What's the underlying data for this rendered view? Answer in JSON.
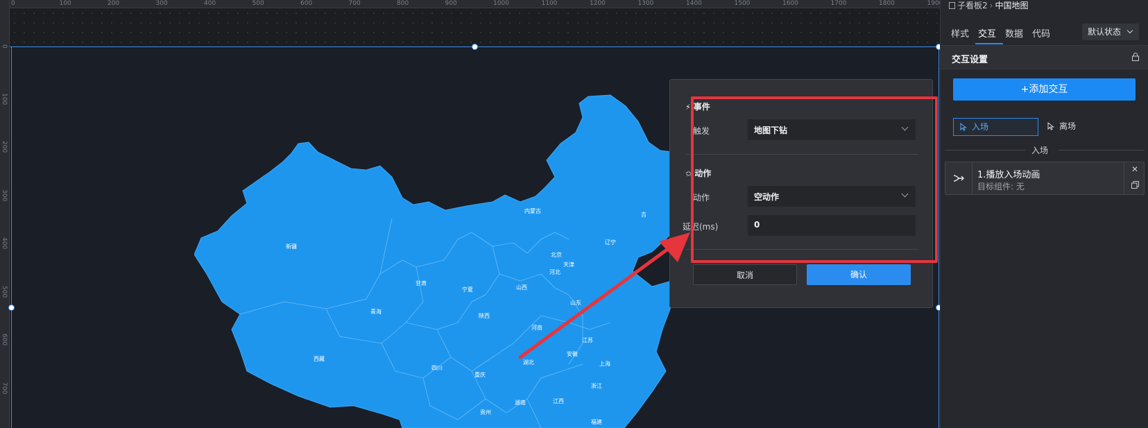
{
  "ruler": {
    "top_ticks": [
      "0",
      "100",
      "200",
      "300",
      "400",
      "500",
      "600",
      "700",
      "800",
      "900",
      "1000",
      "1100",
      "1200",
      "1300",
      "1400",
      "1500",
      "1600",
      "1700",
      "1800",
      "1900"
    ],
    "left_ticks": [
      "0",
      "100",
      "200",
      "300",
      "400",
      "500",
      "600",
      "700"
    ]
  },
  "map": {
    "provinces": [
      "新疆",
      "西藏",
      "青海",
      "甘肃",
      "宁夏",
      "陕西",
      "内蒙古",
      "山西",
      "河北",
      "北京",
      "天津",
      "辽宁",
      "吉",
      "山东",
      "河南",
      "江苏",
      "安徽",
      "上海",
      "湖北",
      "重庆",
      "四川",
      "浙江",
      "湖南",
      "江西",
      "贵州",
      "福建"
    ]
  },
  "dialog": {
    "event_title": "事件",
    "trigger_label": "触发",
    "trigger_value": "地图下钻",
    "action_title": "动作",
    "action_label": "动作",
    "action_value": "空动作",
    "delay_label": "延迟(ms)",
    "delay_value": "0",
    "cancel": "取消",
    "confirm": "确认"
  },
  "panel": {
    "breadcrumb_parent": "子看板2",
    "breadcrumb_current": "中国地图",
    "tabs": [
      "样式",
      "交互",
      "数据",
      "代码"
    ],
    "active_tab": "交互",
    "state": "默认状态",
    "section_title": "交互设置",
    "add_button": "+添加交互",
    "enter_toggle": "入场",
    "leave_toggle": "离场",
    "group_label": "入场",
    "item_title": "1.播放入场动画",
    "item_sub": "目标组件: 无"
  },
  "colors": {
    "accent": "#2b8cf0",
    "map_fill": "#1e96ee",
    "highlight_red": "#e6353c"
  }
}
